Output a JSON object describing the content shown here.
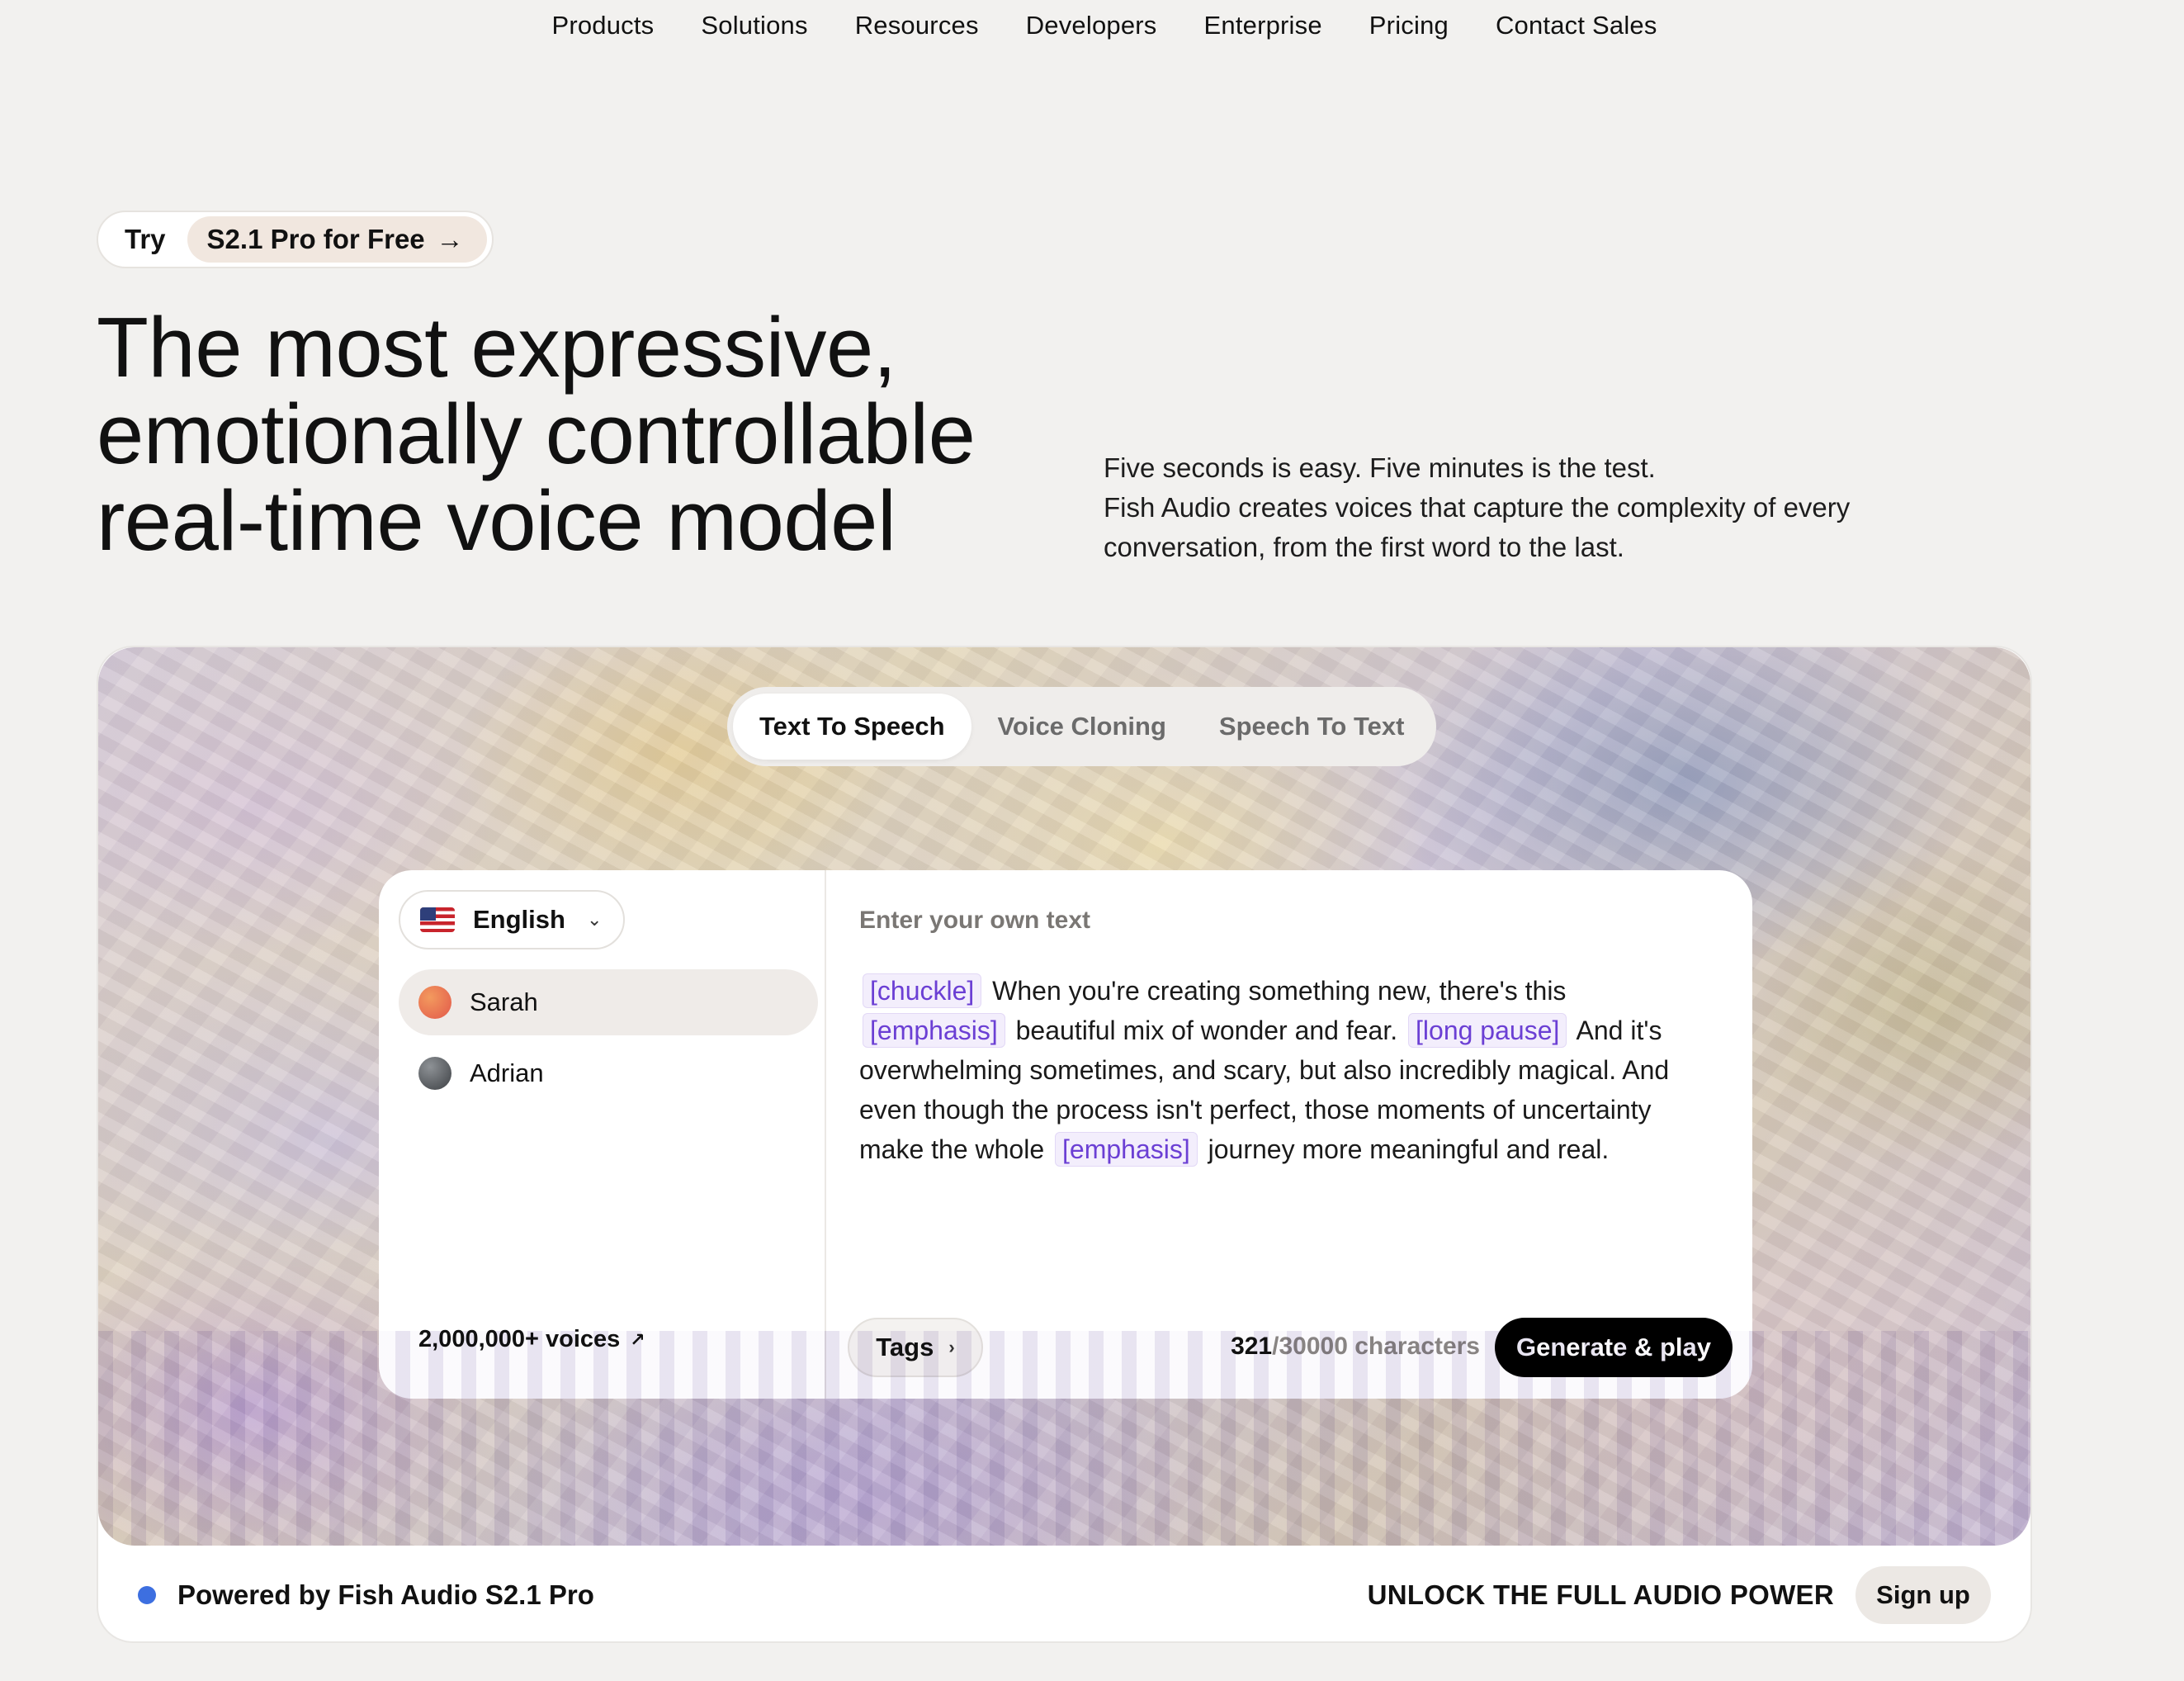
{
  "nav": {
    "items": [
      {
        "label": "Products"
      },
      {
        "label": "Solutions"
      },
      {
        "label": "Resources"
      },
      {
        "label": "Developers"
      },
      {
        "label": "Enterprise"
      },
      {
        "label": "Pricing"
      },
      {
        "label": "Contact Sales"
      }
    ]
  },
  "promo": {
    "try_label": "Try",
    "pill_label": "S2.1 Pro for Free",
    "arrow": "→"
  },
  "hero": {
    "headline_lines": [
      "The most expressive,",
      "emotionally controllable",
      "real-time voice model"
    ],
    "subcopy_lines": [
      "Five seconds is easy. Five minutes is the test.",
      "Fish Audio creates voices that capture the complexity of every",
      "conversation, from the first word to the last."
    ]
  },
  "demo": {
    "tabs": [
      {
        "label": "Text To Speech",
        "active": true
      },
      {
        "label": "Voice Cloning",
        "active": false
      },
      {
        "label": "Speech To Text",
        "active": false
      }
    ],
    "language": {
      "label": "English",
      "icon": "us-flag-icon"
    },
    "voices": [
      {
        "name": "Sarah",
        "selected": true,
        "color": "#e8734f"
      },
      {
        "name": "Adrian",
        "selected": false,
        "color": "#55585c"
      }
    ],
    "voices_link": "2,000,000+ voices",
    "placeholder": "Enter your own text",
    "text_segments": [
      {
        "type": "tag",
        "text": "[chuckle]"
      },
      {
        "type": "text",
        "text": "When you're creating something new, there's this"
      },
      {
        "type": "tag",
        "text": "[emphasis]"
      },
      {
        "type": "text",
        "text": "beautiful mix of wonder and fear."
      },
      {
        "type": "tag",
        "text": "[long pause]"
      },
      {
        "type": "text",
        "text": "And it's overwhelming sometimes, and scary, but also incredibly magical. And even though the process isn't perfect, those moments of uncertainty make the whole"
      },
      {
        "type": "tag",
        "text": "[emphasis]"
      },
      {
        "type": "text",
        "text": "journey more meaningful and real."
      }
    ],
    "tags_button": "Tags",
    "char_used": "321",
    "char_limit": "/30000 characters",
    "generate_label": "Generate & play"
  },
  "footer": {
    "powered_by": "Powered by Fish Audio S2.1 Pro",
    "unlock": "UNLOCK THE FULL AUDIO POWER",
    "signup": "Sign up"
  },
  "colors": {
    "accent_tag": "#6b3fd4",
    "status_dot": "#3d6fe0",
    "background": "#f2f1ef"
  }
}
